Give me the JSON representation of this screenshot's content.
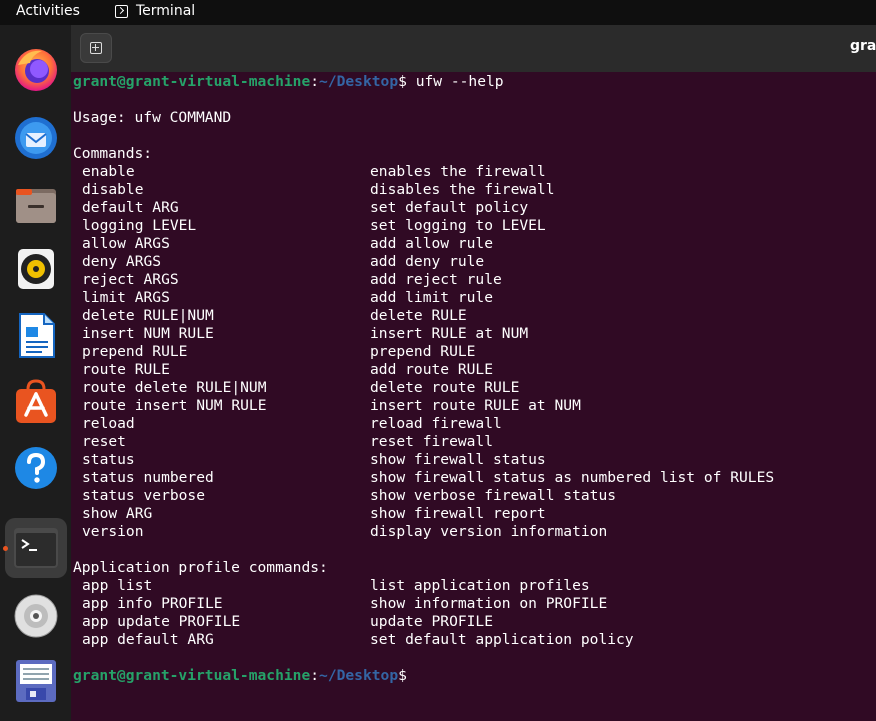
{
  "topbar": {
    "activities_label": "Activities",
    "app_name": "Terminal"
  },
  "dock": {
    "items": [
      {
        "name": "firefox-icon"
      },
      {
        "name": "thunderbird-icon"
      },
      {
        "name": "files-icon"
      },
      {
        "name": "rhythmbox-icon"
      },
      {
        "name": "libreoffice-writer-icon"
      },
      {
        "name": "software-center-icon"
      },
      {
        "name": "help-icon"
      },
      {
        "name": "terminal-icon"
      },
      {
        "name": "dvd-icon"
      },
      {
        "name": "save-disk-icon"
      }
    ]
  },
  "terminal": {
    "window_title": "grant",
    "prompt_user_host": "grant@grant-virtual-machine",
    "prompt_sep": ":",
    "prompt_path": "~/Desktop",
    "prompt_end": "$",
    "command": " ufw --help",
    "usage": "Usage: ufw COMMAND",
    "commands_header": "Commands:",
    "commands": [
      {
        "cmd": "enable",
        "desc": "enables the firewall"
      },
      {
        "cmd": "disable",
        "desc": "disables the firewall"
      },
      {
        "cmd": "default ARG",
        "desc": "set default policy"
      },
      {
        "cmd": "logging LEVEL",
        "desc": "set logging to LEVEL"
      },
      {
        "cmd": "allow ARGS",
        "desc": "add allow rule"
      },
      {
        "cmd": "deny ARGS",
        "desc": "add deny rule"
      },
      {
        "cmd": "reject ARGS",
        "desc": "add reject rule"
      },
      {
        "cmd": "limit ARGS",
        "desc": "add limit rule"
      },
      {
        "cmd": "delete RULE|NUM",
        "desc": "delete RULE"
      },
      {
        "cmd": "insert NUM RULE",
        "desc": "insert RULE at NUM"
      },
      {
        "cmd": "prepend RULE",
        "desc": "prepend RULE"
      },
      {
        "cmd": "route RULE",
        "desc": "add route RULE"
      },
      {
        "cmd": "route delete RULE|NUM",
        "desc": "delete route RULE"
      },
      {
        "cmd": "route insert NUM RULE",
        "desc": "insert route RULE at NUM"
      },
      {
        "cmd": "reload",
        "desc": "reload firewall"
      },
      {
        "cmd": "reset",
        "desc": "reset firewall"
      },
      {
        "cmd": "status",
        "desc": "show firewall status"
      },
      {
        "cmd": "status numbered",
        "desc": "show firewall status as numbered list of RULES"
      },
      {
        "cmd": "status verbose",
        "desc": "show verbose firewall status"
      },
      {
        "cmd": "show ARG",
        "desc": "show firewall report"
      },
      {
        "cmd": "version",
        "desc": "display version information"
      }
    ],
    "app_header": "Application profile commands:",
    "app_commands": [
      {
        "cmd": "app list",
        "desc": "list application profiles"
      },
      {
        "cmd": "app info PROFILE",
        "desc": "show information on PROFILE"
      },
      {
        "cmd": "app update PROFILE",
        "desc": "update PROFILE"
      },
      {
        "cmd": "app default ARG",
        "desc": "set default application policy"
      }
    ]
  },
  "colors": {
    "terminal_bg": "#300a24",
    "prompt_user": "#26a269",
    "prompt_path": "#3465a4",
    "accent": "#e95420"
  }
}
